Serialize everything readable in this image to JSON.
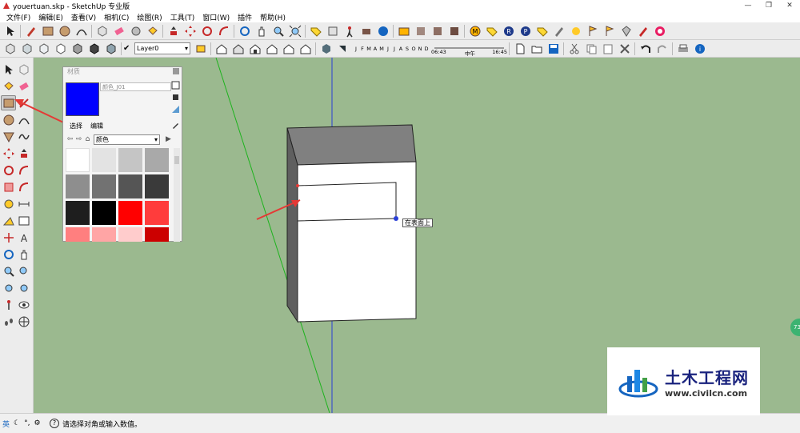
{
  "window": {
    "title": "youertuan.skp - SketchUp 专业版",
    "minimize_glyph": "—",
    "restore_glyph": "❐",
    "close_glyph": "✕"
  },
  "menu": [
    "文件(F)",
    "编辑(E)",
    "查看(V)",
    "相机(C)",
    "绘图(R)",
    "工具(T)",
    "窗口(W)",
    "插件",
    "帮助(H)"
  ],
  "toolbar": {
    "layer": "Layer0",
    "months": [
      "J",
      "F",
      "M",
      "A",
      "M",
      "J",
      "J",
      "A",
      "S",
      "O",
      "N",
      "D"
    ],
    "time_start": "06:43",
    "time_noon": "中午",
    "time_end": "16:45"
  },
  "materials_panel": {
    "title": "材质",
    "material_name": "颜色_J01",
    "tabs": [
      "选择",
      "编辑"
    ],
    "library": "颜色",
    "swatch_colors": [
      "#ffffff",
      "#e3e3e3",
      "#c5c5c5",
      "#a9a9a9",
      "#8e8e8e",
      "#727272",
      "#555555",
      "#3a3a3a",
      "#1e1e1e",
      "#000000",
      "#ff0000",
      "#ff3c3c",
      "#ff7f7f",
      "#ffa5a5",
      "#ffcccc",
      "#cc0000"
    ],
    "selected_color": "#0000ff"
  },
  "viewport": {
    "tooltip": "在表面上",
    "background": "#9bb98f"
  },
  "status": {
    "ime_lang": "英",
    "message": "请选择对角或输入数值。"
  },
  "watermark": {
    "title": "土木工程网",
    "url": "www.civilcn.com"
  },
  "side_badge": "73"
}
